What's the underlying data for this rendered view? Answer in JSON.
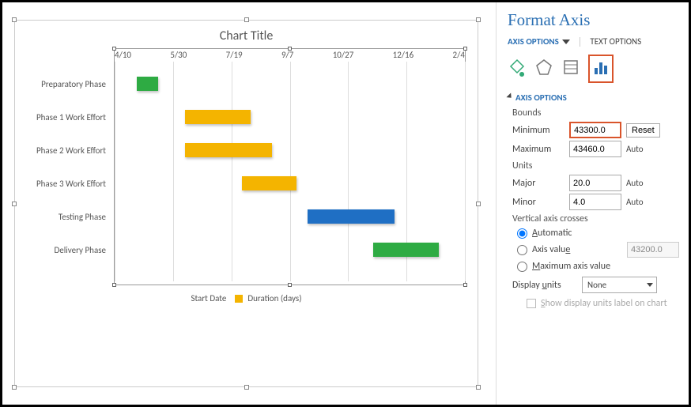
{
  "chart_data": {
    "type": "gantt",
    "title": "Chart Title",
    "x_axis": {
      "min": 43300.0,
      "max": 43460.0,
      "major_unit": 20.0,
      "minor_unit": 4.0,
      "ticks": [
        "4/10",
        "5/30",
        "7/19",
        "9/7",
        "10/27",
        "12/16",
        "2/4"
      ]
    },
    "tasks": [
      {
        "name": "Preparatory Phase",
        "start": 43310,
        "duration": 10,
        "color": "#2EAB43"
      },
      {
        "name": "Phase 1 Work Effort",
        "start": 43332,
        "duration": 30,
        "color": "#F4B400"
      },
      {
        "name": "Phase 2 Work Effort",
        "start": 43332,
        "duration": 40,
        "color": "#F4B400"
      },
      {
        "name": "Phase 3 Work Effort",
        "start": 43358,
        "duration": 25,
        "color": "#F4B400"
      },
      {
        "name": "Testing Phase",
        "start": 43388,
        "duration": 40,
        "color": "#1F6FC4"
      },
      {
        "name": "Delivery Phase",
        "start": 43418,
        "duration": 30,
        "color": "#2EAB43"
      }
    ],
    "legend": [
      "Start Date",
      "Duration (days)"
    ]
  },
  "panel": {
    "title": "Format Axis",
    "tabs": {
      "axis_options": "AXIS OPTIONS",
      "text_options": "TEXT OPTIONS"
    },
    "section": "AXIS OPTIONS",
    "bounds": {
      "label": "Bounds",
      "min_label": "Minimum",
      "min": "43300.0",
      "max_label": "Maximum",
      "max": "43460.0",
      "reset": "Reset",
      "auto": "Auto"
    },
    "units": {
      "label": "Units",
      "major_label": "Major",
      "major": "20.0",
      "minor_label": "Minor",
      "minor": "4.0",
      "auto": "Auto"
    },
    "crosses": {
      "label": "Vertical axis crosses",
      "automatic": "Automatic",
      "axis_value": "Axis value",
      "axis_value_box": "43200.0",
      "max": "Maximum axis value"
    },
    "display_units": {
      "label": "Display units",
      "value": "None"
    },
    "show_label_chk": "Show display units label on chart"
  }
}
